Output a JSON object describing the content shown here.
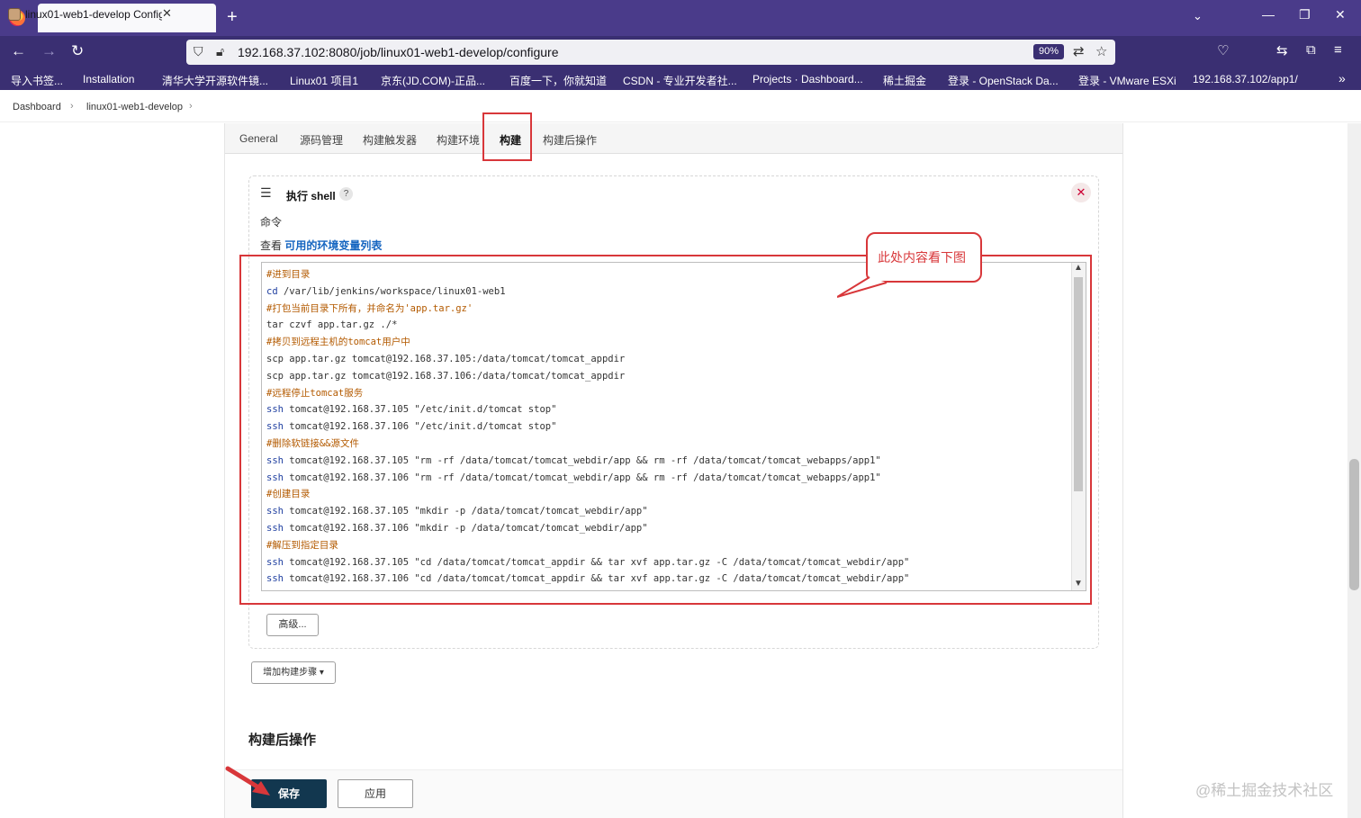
{
  "browser": {
    "tab_title": "linux01-web1-develop Config",
    "url": "192.168.37.102:8080/job/linux01-web1-develop/configure",
    "zoom": "90%",
    "bookmarks": [
      "导入书签...",
      "Installation",
      "清华大学开源软件镜...",
      "Linux01 项目1",
      "京东(JD.COM)-正品...",
      "百度一下，你就知道",
      "CSDN - 专业开发者社...",
      "Projects · Dashboard...",
      "稀土掘金",
      "登录 - OpenStack Da...",
      "登录 - VMware ESXi",
      "192.168.37.102/app1/"
    ]
  },
  "breadcrumb": [
    "Dashboard",
    "linux01-web1-develop"
  ],
  "config_tabs": [
    "General",
    "源码管理",
    "构建触发器",
    "构建环境",
    "构建",
    "构建后操作"
  ],
  "active_tab": "构建",
  "build_step": {
    "title": "执行 shell",
    "help": "?",
    "command_label": "命令",
    "env_prefix": "查看",
    "env_link": "可用的环境变量列表",
    "callout": "此处内容看下图",
    "code": [
      {
        "type": "comment",
        "text": "#进到目录"
      },
      {
        "type": "cmd",
        "kw": "cd",
        "rest": " /var/lib/jenkins/workspace/linux01-web1"
      },
      {
        "type": "comment",
        "text": "#打包当前目录下所有，并命名为'app.tar.gz'"
      },
      {
        "type": "plain",
        "text": "tar czvf app.tar.gz ./*"
      },
      {
        "type": "comment",
        "text": "#拷贝到远程主机的tomcat用户中"
      },
      {
        "type": "plain",
        "text": "scp app.tar.gz tomcat@192.168.37.105:/data/tomcat/tomcat_appdir"
      },
      {
        "type": "plain",
        "text": "scp app.tar.gz tomcat@192.168.37.106:/data/tomcat/tomcat_appdir"
      },
      {
        "type": "comment",
        "text": "#远程停止tomcat服务"
      },
      {
        "type": "cmd",
        "kw": "ssh",
        "rest": " tomcat@192.168.37.105 \"/etc/init.d/tomcat stop\""
      },
      {
        "type": "cmd",
        "kw": "ssh",
        "rest": " tomcat@192.168.37.106 \"/etc/init.d/tomcat stop\""
      },
      {
        "type": "comment",
        "text": "#删除软链接&&源文件"
      },
      {
        "type": "cmd",
        "kw": "ssh",
        "rest": " tomcat@192.168.37.105 \"rm -rf /data/tomcat/tomcat_webdir/app && rm -rf /data/tomcat/tomcat_webapps/app1\""
      },
      {
        "type": "cmd",
        "kw": "ssh",
        "rest": " tomcat@192.168.37.106 \"rm -rf /data/tomcat/tomcat_webdir/app && rm -rf /data/tomcat/tomcat_webapps/app1\""
      },
      {
        "type": "comment",
        "text": "#创建目录"
      },
      {
        "type": "cmd",
        "kw": "ssh",
        "rest": " tomcat@192.168.37.105 \"mkdir -p /data/tomcat/tomcat_webdir/app\""
      },
      {
        "type": "cmd",
        "kw": "ssh",
        "rest": " tomcat@192.168.37.106 \"mkdir -p /data/tomcat/tomcat_webdir/app\""
      },
      {
        "type": "comment",
        "text": "#解压到指定目录"
      },
      {
        "type": "cmd",
        "kw": "ssh",
        "rest": " tomcat@192.168.37.105 \"cd /data/tomcat/tomcat_appdir && tar xvf app.tar.gz -C /data/tomcat/tomcat_webdir/app\""
      },
      {
        "type": "cmd",
        "kw": "ssh",
        "rest": " tomcat@192.168.37.106 \"cd /data/tomcat/tomcat_appdir && tar xvf app.tar.gz -C /data/tomcat/tomcat_webdir/app\""
      }
    ],
    "advanced_label": "高级...",
    "add_step_label": "增加构建步骤 ▾"
  },
  "post_build_title": "构建后操作",
  "buttons": {
    "save": "保存",
    "apply": "应用"
  },
  "watermark": "@稀土掘金技术社区",
  "colors": {
    "accent_red": "#d8373a",
    "firefox_purple": "#4a3b8a",
    "save_btn": "#12374f"
  }
}
